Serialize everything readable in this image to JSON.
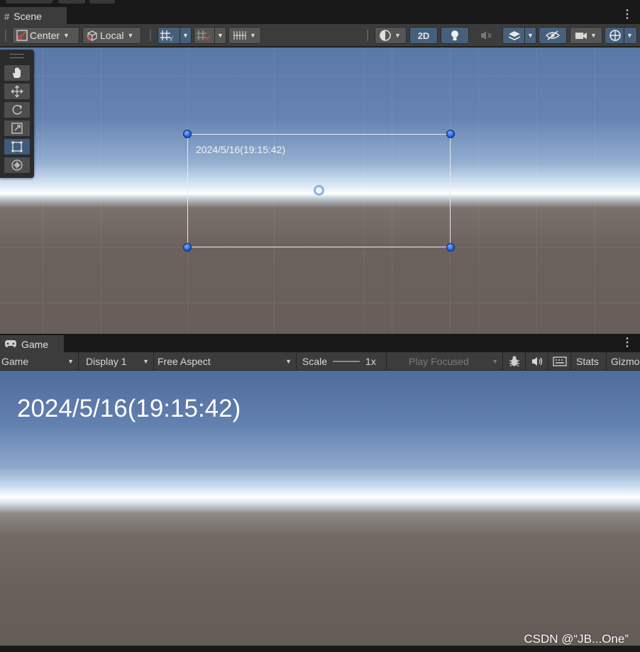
{
  "scene_tab": {
    "label": "Scene"
  },
  "scene_toolbar": {
    "pivot_mode": "Center",
    "pivot_rotation": "Local",
    "mode_2d": "2D"
  },
  "scene_view": {
    "text_object": "2024/5/16(19:15:42)"
  },
  "tools": [
    "hand-tool",
    "move-tool",
    "rotate-tool",
    "scale-tool",
    "rect-tool",
    "transform-tool"
  ],
  "game_tab": {
    "label": "Game"
  },
  "game_toolbar": {
    "view_mode": "Game",
    "display": "Display 1",
    "aspect": "Free Aspect",
    "scale_label": "Scale",
    "scale_value": "1x",
    "play_mode": "Play Focused",
    "stats": "Stats",
    "gizmos": "Gizmo"
  },
  "game_view": {
    "text_object": "2024/5/16(19:15:42)"
  },
  "watermark": "CSDN @“JB...One”",
  "colors": {
    "active_button": "#46607c",
    "handle": "#1f5fd6",
    "panel": "#3c3c3c"
  }
}
